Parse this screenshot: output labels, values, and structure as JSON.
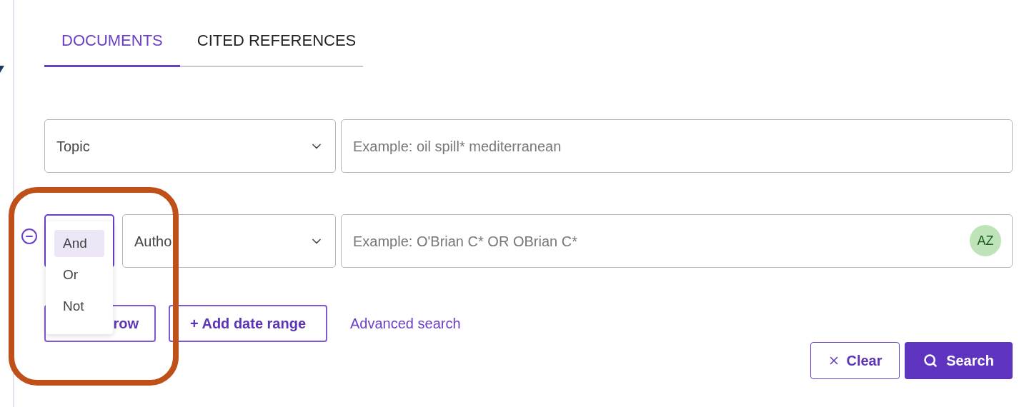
{
  "tabs": [
    {
      "label": "DOCUMENTS",
      "selected": true
    },
    {
      "label": "CITED REFERENCES",
      "selected": false
    }
  ],
  "rows": [
    {
      "field": "Topic",
      "placeholder": "Example: oil spill* mediterranean"
    },
    {
      "field": "Autho",
      "placeholder": "Example: O'Brian C* OR OBrian C*",
      "badge": "AZ",
      "operator_menu": {
        "expanded": true,
        "options": [
          {
            "label": "And",
            "selected": true
          },
          {
            "label": "Or",
            "selected": false
          },
          {
            "label": "Not",
            "selected": false
          }
        ]
      }
    }
  ],
  "actions": {
    "add_row": "row",
    "add_date_range": "+ Add date range",
    "advanced_search": "Advanced search"
  },
  "buttons": {
    "clear": "Clear",
    "search": "Search"
  }
}
